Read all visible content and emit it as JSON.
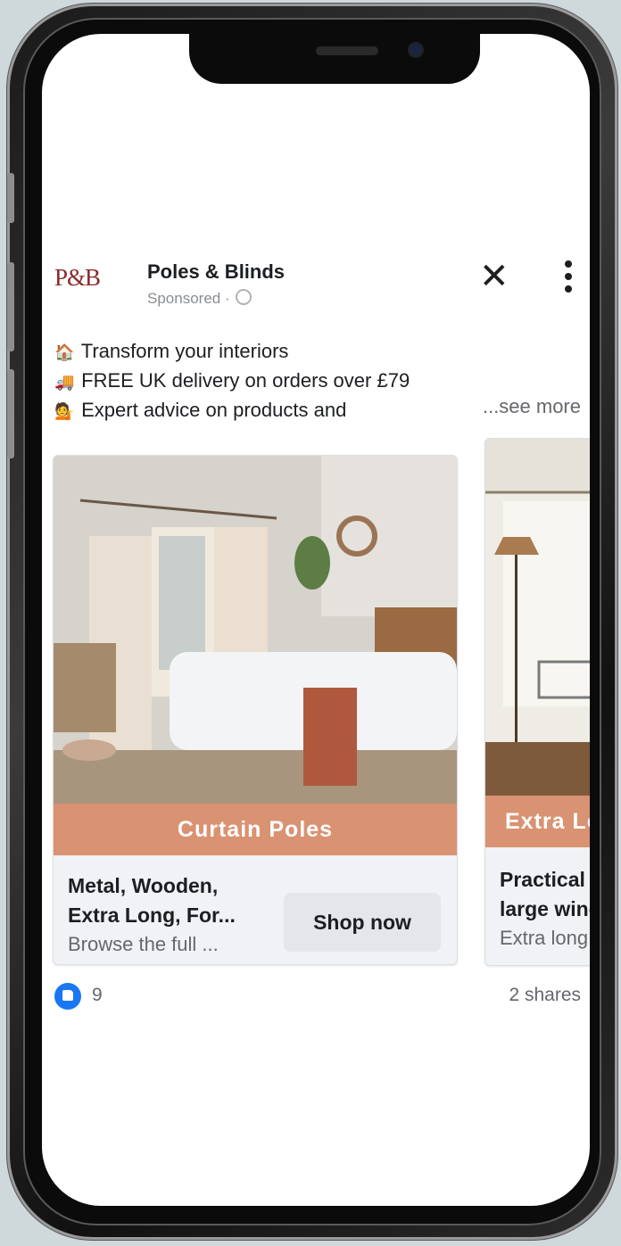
{
  "ad": {
    "logo_text": "P&B",
    "page_name": "Poles & Blinds",
    "sponsored": "Sponsored ·",
    "lines": [
      {
        "icon": "house-icon",
        "emoji": "🏠",
        "text": "Transform your interiors"
      },
      {
        "icon": "truck-icon",
        "emoji": "🚚",
        "text": "FREE UK delivery on orders over £79"
      },
      {
        "icon": "person-icon",
        "emoji": "💁",
        "text": "Expert advice on products and"
      }
    ],
    "see_more": "...see more"
  },
  "carousel": {
    "cards": [
      {
        "tag": "Curtain Poles",
        "title_line1": "Metal, Wooden,",
        "title_line2": "Extra Long, For...",
        "description": "Browse the full ...",
        "button": "Shop now"
      },
      {
        "tag": "Extra Lon",
        "title_line1": "Practical f",
        "title_line2": "large wind",
        "description": "Extra long"
      }
    ]
  },
  "footer": {
    "likes": "9",
    "shares": "2 shares"
  },
  "colors": {
    "tag_background": "#d99272",
    "brand_logo": "#8b2b2b",
    "like_blue": "#1877f2"
  }
}
